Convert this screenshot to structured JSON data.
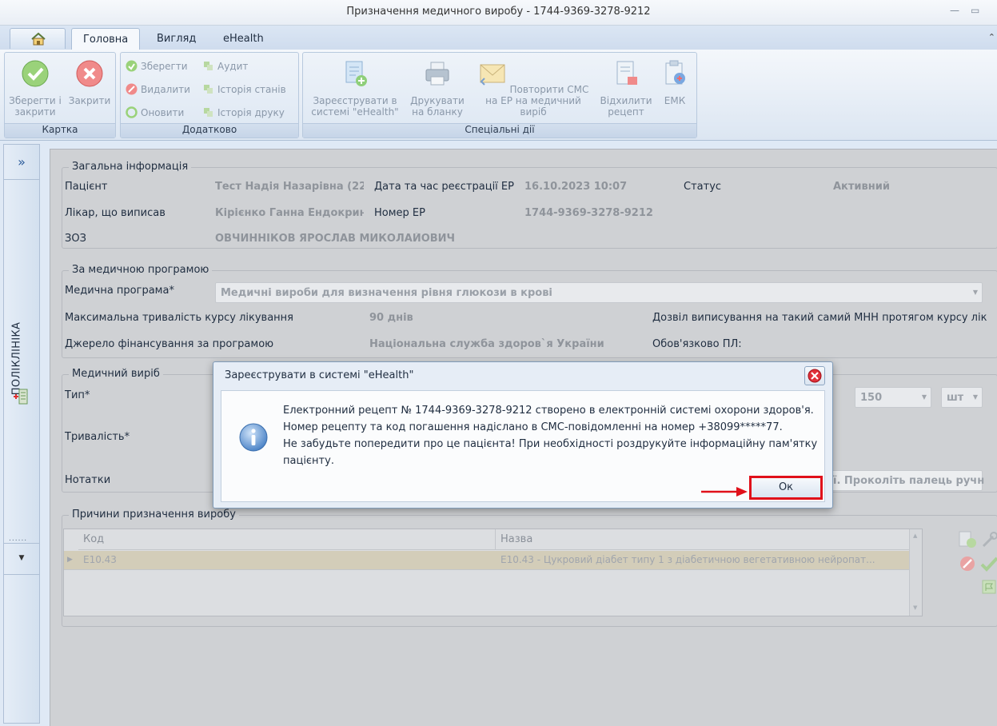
{
  "window": {
    "title": "Призначення медичного виробу - 1744-9369-3278-9212"
  },
  "tabs": [
    {
      "label": "Головна",
      "active": true
    },
    {
      "label": "Вигляд",
      "active": false
    },
    {
      "label": "eHealth",
      "active": false
    }
  ],
  "ribbon": {
    "card_group": {
      "caption": "Картка",
      "save_close": "Зберегти і закрити",
      "close": "Закрити"
    },
    "extra_group": {
      "caption": "Додатково",
      "save": "Зберегти",
      "delete": "Видалити",
      "refresh": "Оновити",
      "audit": "Аудит",
      "status_history": "Історія станів",
      "print_history": "Історія друку"
    },
    "special_group": {
      "caption": "Спеціальні дії",
      "register": "Зареєструвати в системі \"eHealth\"",
      "print_form": "Друкувати на бланку",
      "repeat_sms": "Повторити СМС на ЕР на медичний виріб",
      "reject": "Відхилити рецепт",
      "emk": "ЕМК"
    }
  },
  "sidebar": {
    "label": "ПОЛІКЛІНІКА"
  },
  "general": {
    "legend": "Загальна інформація",
    "patient_label": "Пацієнт",
    "patient_value": "Тест Надія Назарівна (22.(",
    "reg_date_label": "Дата та час реєстрації ЕР",
    "reg_date_value": "16.10.2023 10:07",
    "status_label": "Статус",
    "status_value": "Активний",
    "doctor_label": "Лікар, що виписав",
    "doctor_value": "Кірієнко Ганна Ендокринс",
    "ep_number_label": "Номер ЕР",
    "ep_number_value": "1744-9369-3278-9212",
    "zoz_label": "ЗОЗ",
    "zoz_value": "ОВЧИННІКОВ ЯРОСЛАВ МИКОЛАЙОВИЧ"
  },
  "program": {
    "legend": "За медичною програмою",
    "program_label": "Медична програма*",
    "program_value": "Медичні вироби для визначення рівня глюкози в крові",
    "max_duration_label": "Максимальна тривалість курсу лікування",
    "max_duration_value": "90 днів",
    "permit_label": "Дозвіл виписування на такий самий МНН протягом курсу лік",
    "funding_label": "Джерело фінансування за програмою",
    "funding_value": "Національна служба здоров`я України",
    "mandatory_label": "Обов'язково ПЛ:"
  },
  "device": {
    "legend": "Медичний виріб",
    "type_label": "Тип*",
    "quantity_value": "150",
    "unit_value": "шт",
    "duration_label": "Тривалість*",
    "notes_label": "Нотатки",
    "notes_value": "ї. Проколіть палець ручн"
  },
  "reasons": {
    "legend": "Причини призначення виробу",
    "columns": [
      "Код",
      "Назва"
    ],
    "rows": [
      {
        "code": "E10.43",
        "name": "E10.43 - Цукровий діабет типу 1 з діабетичною вегетативною нейропат..."
      }
    ]
  },
  "dialog": {
    "title": "Зареєструвати в системі \"eHealth\"",
    "lines": [
      "Електронний рецепт № 1744-9369-3278-9212 створено в електронній системі охорони здоров'я.",
      "Номер рецепту та код погашення надіслано в СМС-повідомленні на номер +38099*****77.",
      "Не забудьте попередити про це пацієнта! При необхідності роздрукуйте інформаційну пам'ятку",
      "пацієнту."
    ],
    "ok_label": "Ок"
  },
  "colors": {
    "highlight": "#e0101a",
    "ribbon_bg": "#dce6f2",
    "content_bg": "#cfd1d4"
  }
}
